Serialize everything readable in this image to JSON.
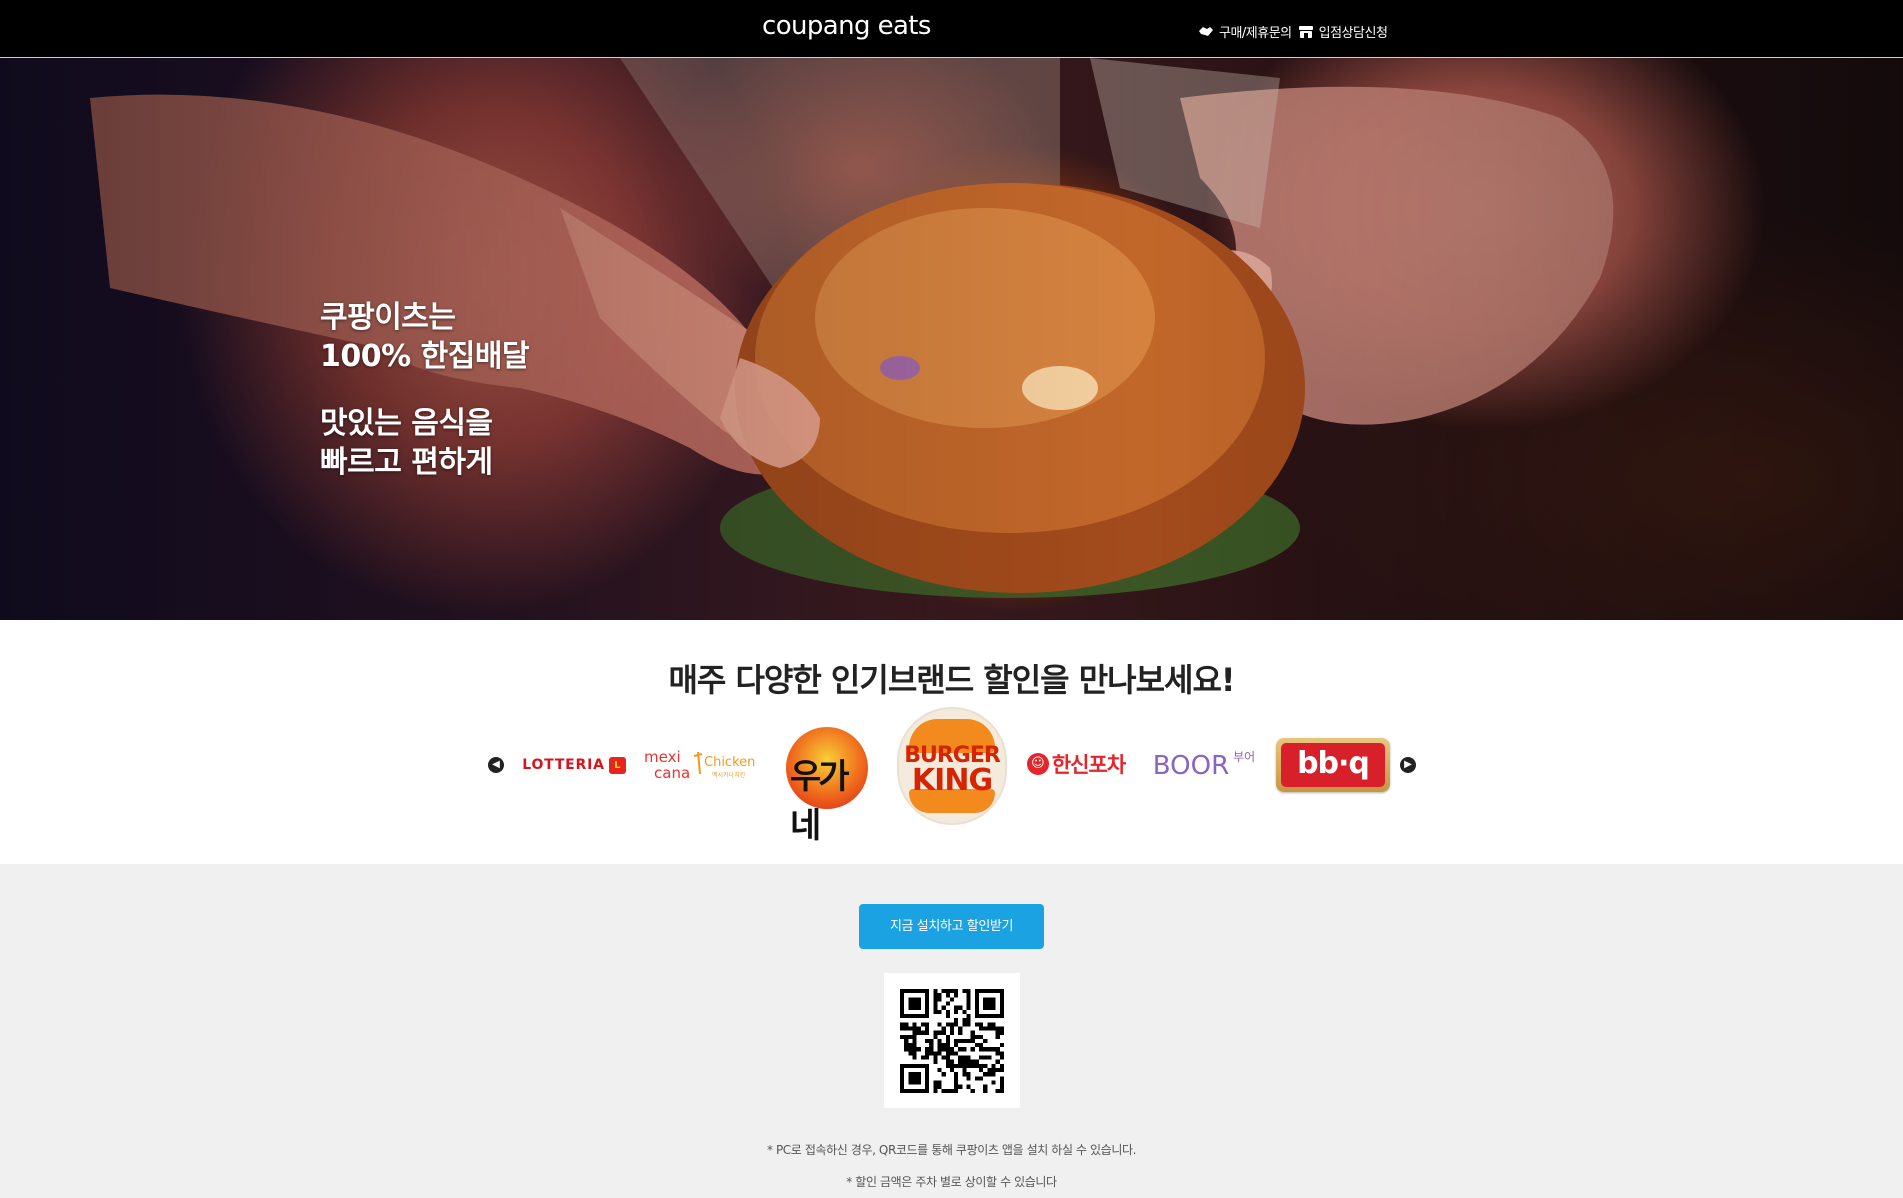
{
  "header": {
    "logo": "coupang eats",
    "links": [
      {
        "label": "구매/제휴문의",
        "icon": "handshake-icon"
      },
      {
        "label": "입점상담신청",
        "icon": "store-icon"
      }
    ]
  },
  "hero": {
    "line1": "쿠팡이츠는",
    "line2": "100% 한집배달",
    "line3": "맛있는 음식을",
    "line4": "빠르고 편하게"
  },
  "brands": {
    "title": "매주 다양한 인기브랜드 할인을 만나보세요!",
    "logos": {
      "lotteria": "LOTTERIA",
      "mexicana_top": "mexi",
      "mexicana_bottom": "cana",
      "mexicana_chicken": "Chicken",
      "mexicana_sub": "멕시카나치킨",
      "uga": "우가네",
      "bk_line1": "BURGER",
      "bk_line2": "KING",
      "hansin": "한신포차",
      "boor": "BOOR",
      "boor_kr": "부어",
      "bbq": "bb·q"
    },
    "prev_icon": "chevron-left-icon",
    "next_icon": "chevron-right-icon"
  },
  "download": {
    "install_button": "지금 설치하고 할인받기",
    "note1": "* PC로 접속하신 경우, QR코드를 통해 쿠팡이츠 앱을 설치 하실 수 있습니다.",
    "note2": "* 할인 금액은 주차 별로 상이할 수 있습니다"
  },
  "colors": {
    "header_bg": "#000000",
    "install_button": "#1aa2e3",
    "section_bg": "#f1f0f1"
  }
}
